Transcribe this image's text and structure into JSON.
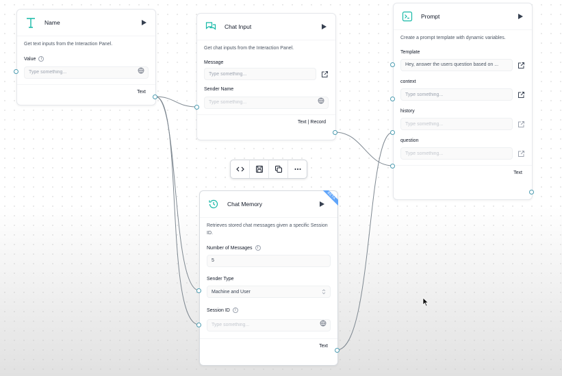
{
  "nodes": {
    "name": {
      "title": "Name",
      "description": "Get text inputs from the Interaction Panel.",
      "field_label": "Value",
      "placeholder": "Type something...",
      "output": "Text"
    },
    "chat_input": {
      "title": "Chat Input",
      "description": "Get chat inputs from the Interaction Panel.",
      "message_label": "Message",
      "message_placeholder": "Type something...",
      "sender_label": "Sender Name",
      "sender_placeholder": "Type something...",
      "output": "Text | Record"
    },
    "prompt": {
      "title": "Prompt",
      "description": "Create a prompt template with dynamic variables.",
      "template_label": "Template",
      "template_value": "Hey, answer the users question based on ...",
      "context_label": "context",
      "context_placeholder": "Type something...",
      "history_label": "history",
      "history_placeholder": "Type something...",
      "question_label": "question",
      "question_placeholder": "Type something...",
      "output": "Text"
    },
    "chat_memory": {
      "title": "Chat Memory",
      "badge": "BETA",
      "description": "Retrieves stored chat messages given a specific Session ID.",
      "num_label": "Number of Messages",
      "num_value": "5",
      "sender_type_label": "Sender Type",
      "sender_type_value": "Machine and User",
      "session_label": "Session ID",
      "session_placeholder": "Type something...",
      "output": "Text"
    }
  },
  "toolbar": {
    "buttons": [
      "code-icon",
      "save-icon",
      "duplicate-icon",
      "more-icon"
    ]
  },
  "colors": {
    "accent": "#14b8a6",
    "edge": "#7d8790",
    "handle": "#4b9bb0"
  }
}
